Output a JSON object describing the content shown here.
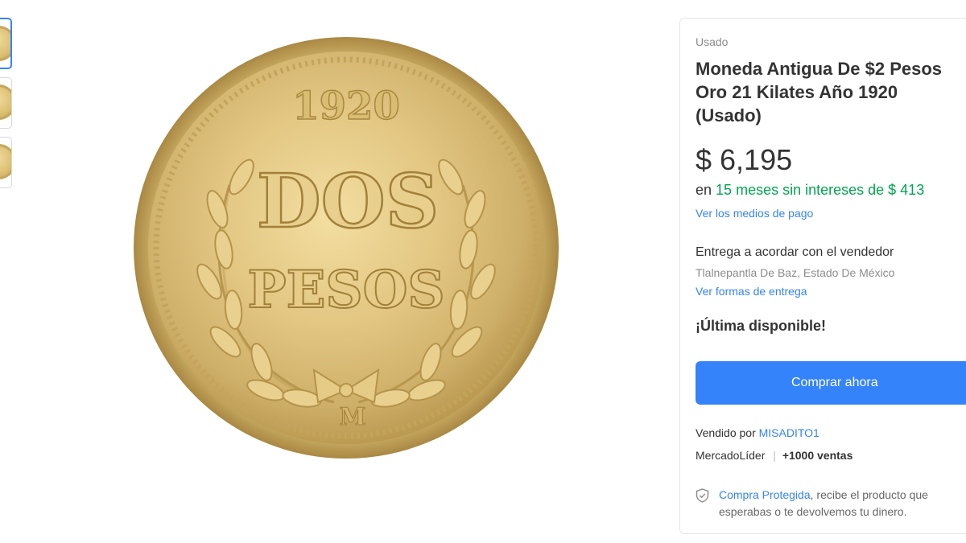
{
  "gallery": {
    "thumbnails": [
      {
        "name": "thumb-1",
        "selected": true
      },
      {
        "name": "thumb-2",
        "selected": false
      },
      {
        "name": "thumb-3",
        "selected": false
      }
    ],
    "coin": {
      "year": "1920",
      "line1": "DOS",
      "line2": "PESOS",
      "mint_mark": "M"
    }
  },
  "product": {
    "condition": "Usado",
    "title": "Moneda Antigua De $2 Pesos Oro 21 Kilates Año 1920 (Usado)",
    "price": "$ 6,195",
    "installments_prefix": "en",
    "installments_highlight": "15 meses sin intereses de $ 413",
    "payment_link": "Ver los medios de pago"
  },
  "delivery": {
    "title": "Entrega a acordar con el vendedor",
    "location": "Tlalnepantla De Baz, Estado De México",
    "link": "Ver formas de entrega"
  },
  "stock": "¡Última disponible!",
  "buy_button": "Comprar ahora",
  "seller": {
    "prefix": "Vendido por",
    "name": "MISADITO1",
    "status": "MercadoLíder",
    "separator": "|",
    "sales": "+1000 ventas"
  },
  "protection": {
    "link": "Compra Protegida",
    "text": ", recibe el producto que esperabas o te devolvemos tu dinero.",
    "icon": "shield-check-icon"
  },
  "colors": {
    "accent": "#3483fa",
    "green": "#00a650",
    "gold": "#d8bd73"
  }
}
